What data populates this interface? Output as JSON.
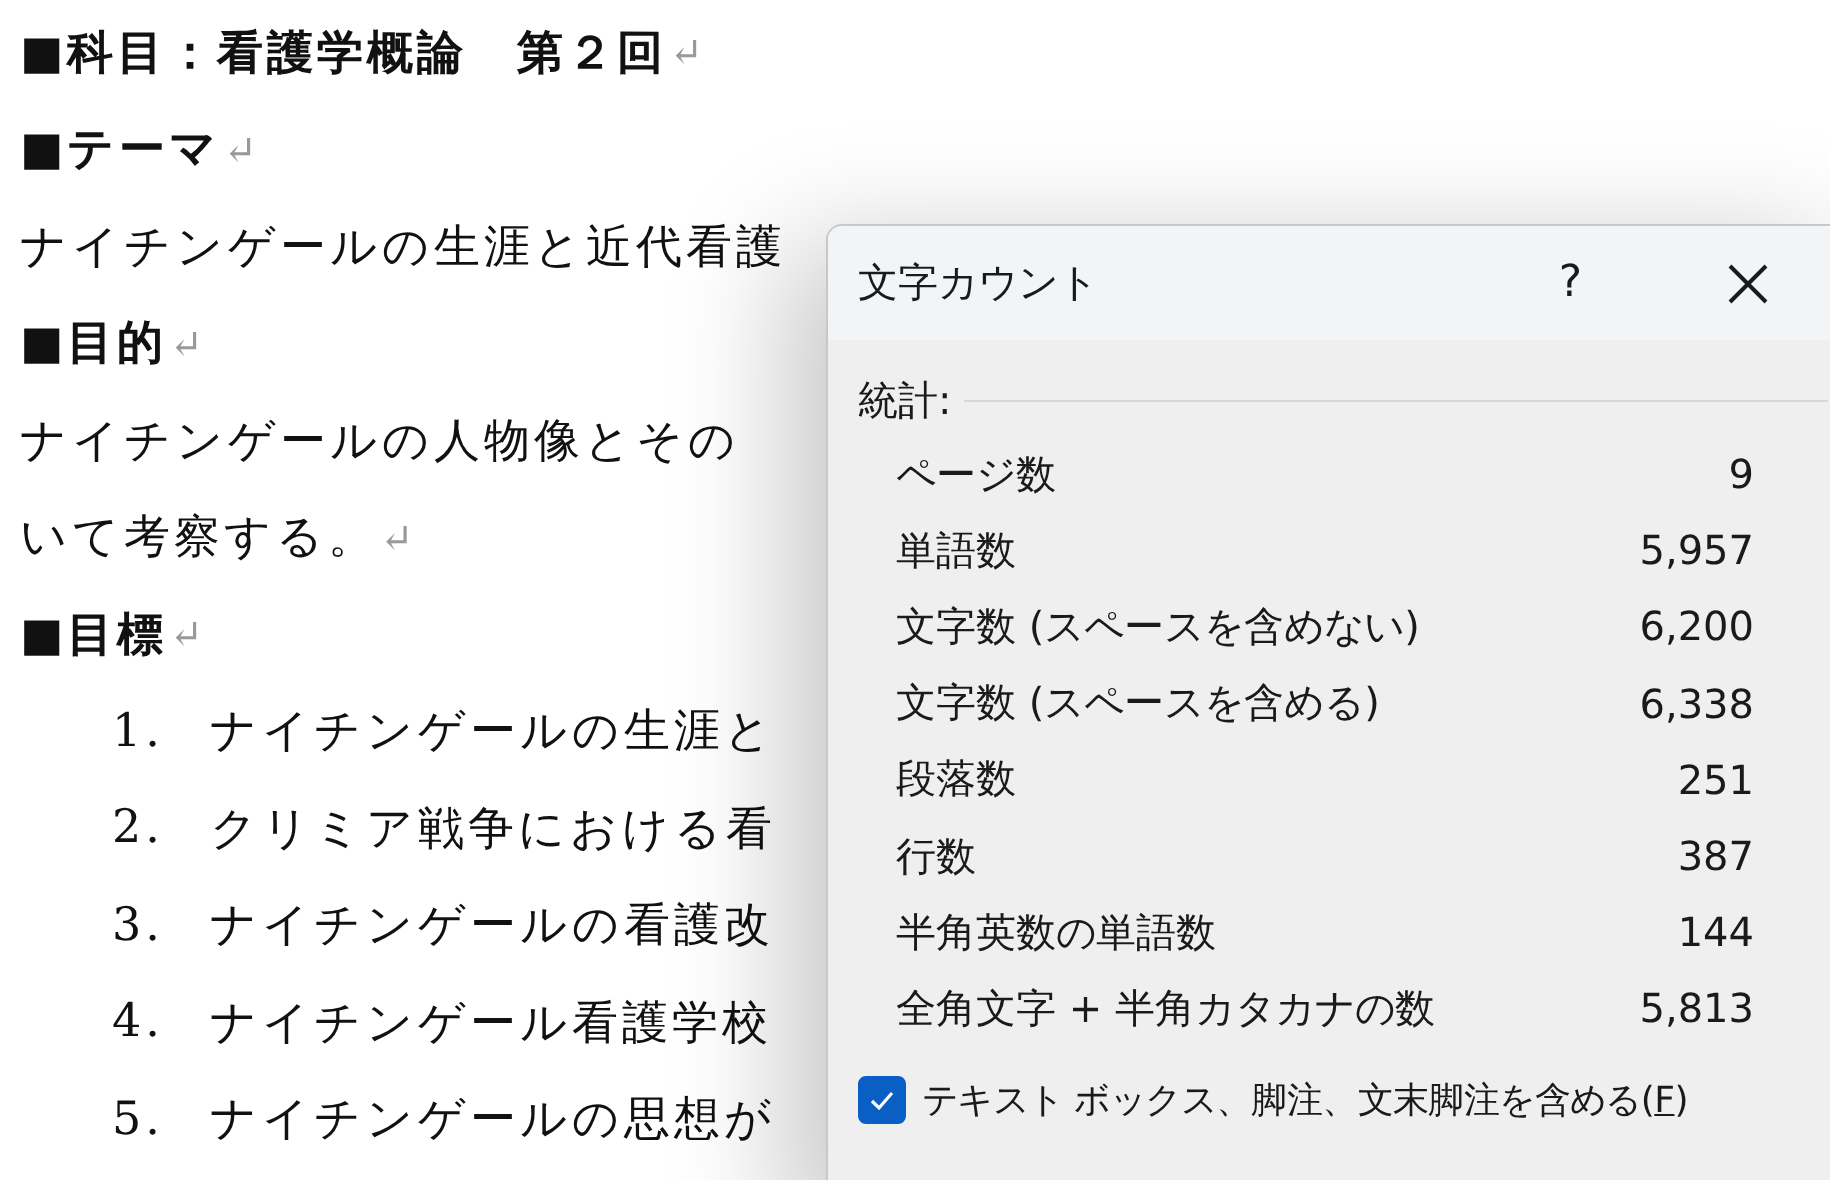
{
  "document": {
    "paragraphs": [
      {
        "kind": "heading",
        "text": "■科目：看護学概論　第２回",
        "mark": "↵"
      },
      {
        "kind": "heading",
        "text": "■テーマ",
        "mark": "↵"
      },
      {
        "kind": "body",
        "text": "ナイチンゲールの生涯と近代看護"
      },
      {
        "kind": "heading",
        "text": "■目的",
        "mark": "↵"
      },
      {
        "kind": "body",
        "text": "ナイチンゲールの人物像とその"
      },
      {
        "kind": "body",
        "text": "いて考察する。",
        "mark": "↵"
      },
      {
        "kind": "heading",
        "text": "■目標",
        "mark": "↵"
      }
    ],
    "list": [
      {
        "number": "1.",
        "text": "ナイチンゲールの生涯と"
      },
      {
        "number": "2.",
        "text": "クリミア戦争における看"
      },
      {
        "number": "3.",
        "text": "ナイチンゲールの看護改"
      },
      {
        "number": "4.",
        "text": "ナイチンゲール看護学校"
      },
      {
        "number": "5.",
        "text": "ナイチンゲールの思想が"
      }
    ]
  },
  "dialog": {
    "title": "文字カウント",
    "help": "?",
    "section": "統計:",
    "stats": [
      {
        "label": "ページ数",
        "value": "9"
      },
      {
        "label": "単語数",
        "value": "5,957"
      },
      {
        "label": "文字数 (スペースを含めない)",
        "value": "6,200"
      },
      {
        "label": "文字数 (スペースを含める)",
        "value": "6,338"
      },
      {
        "label": "段落数",
        "value": "251"
      },
      {
        "label": "行数",
        "value": "387"
      },
      {
        "label": "半角英数の単語数",
        "value": "144"
      },
      {
        "label": "全角文字 + 半角カタカナの数",
        "value": "5,813"
      }
    ],
    "option": {
      "label_before": "テキスト ボックス、脚注、文末脚注を含める(",
      "access_key": "F",
      "label_after": ")",
      "checked": true
    }
  }
}
